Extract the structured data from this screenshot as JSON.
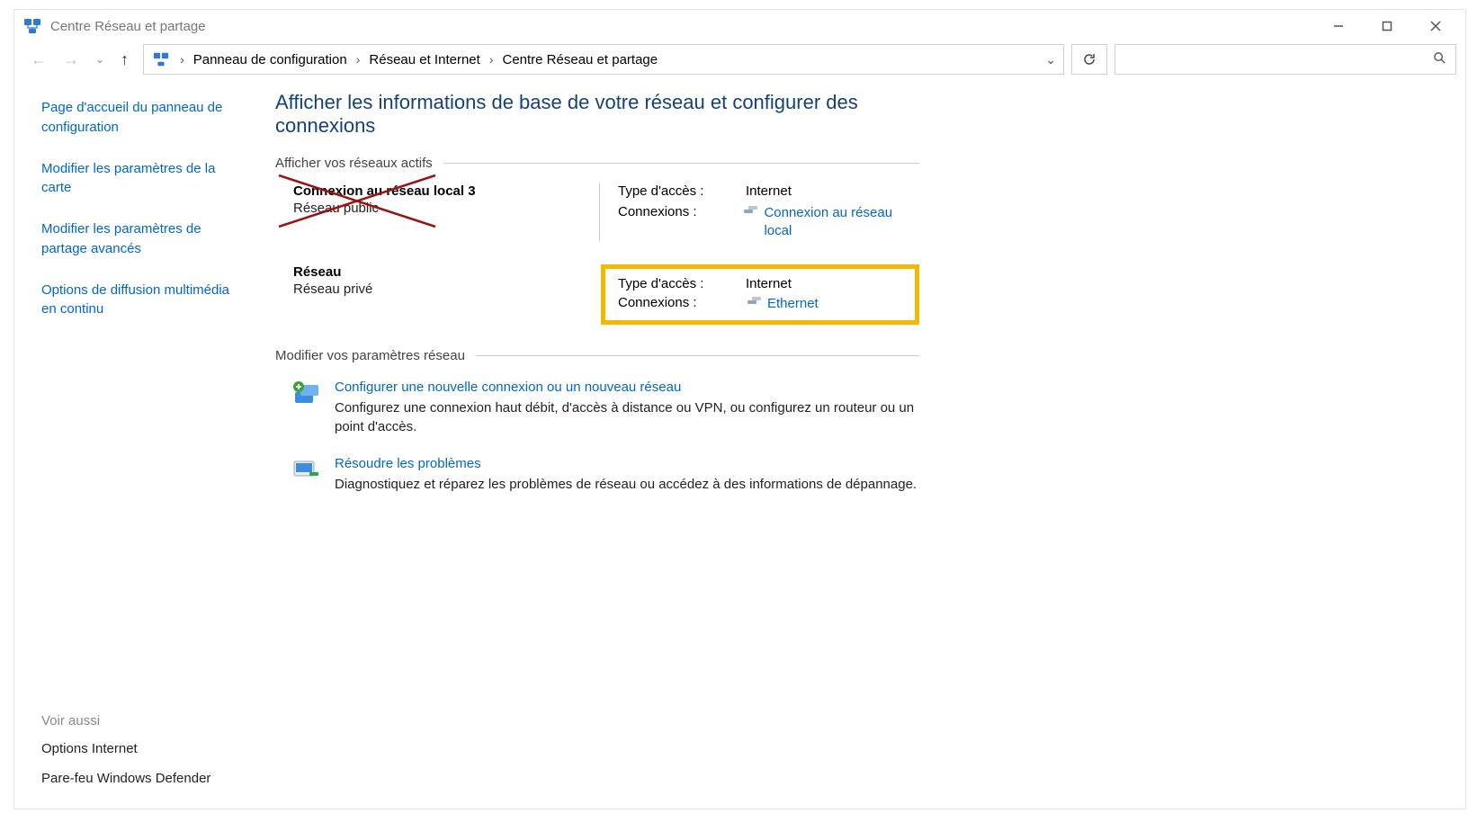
{
  "titlebar": {
    "title": "Centre Réseau et partage"
  },
  "breadcrumb": {
    "items": [
      "Panneau de configuration",
      "Réseau et Internet",
      "Centre Réseau et partage"
    ]
  },
  "sidebar": {
    "links": [
      "Page d'accueil du panneau de configuration",
      "Modifier les paramètres de la carte",
      "Modifier les paramètres de partage avancés",
      "Options de diffusion multimédia en continu"
    ],
    "see_also_label": "Voir aussi",
    "see_also": [
      "Options Internet",
      "Pare-feu Windows Defender"
    ]
  },
  "main": {
    "page_title": "Afficher les informations de base de votre réseau et configurer des connexions",
    "active_networks_heading": "Afficher vos réseaux actifs",
    "networks": [
      {
        "name": "Connexion au réseau local 3",
        "category": "Réseau public",
        "access_label": "Type d'accès :",
        "access_value": "Internet",
        "connections_label": "Connexions :",
        "connection_link": "Connexion au réseau local",
        "crossed": true,
        "highlighted": false
      },
      {
        "name": "Réseau",
        "category": "Réseau privé",
        "access_label": "Type d'accès :",
        "access_value": "Internet",
        "connections_label": "Connexions :",
        "connection_link": "Ethernet",
        "crossed": false,
        "highlighted": true
      }
    ],
    "change_settings_heading": "Modifier vos paramètres réseau",
    "actions": [
      {
        "title": "Configurer une nouvelle connexion ou un nouveau réseau",
        "desc": "Configurez une connexion haut débit, d'accès à distance ou VPN, ou configurez un routeur ou un point d'accès."
      },
      {
        "title": "Résoudre les problèmes",
        "desc": "Diagnostiquez et réparez les problèmes de réseau ou accédez à des informations de dépannage."
      }
    ]
  }
}
